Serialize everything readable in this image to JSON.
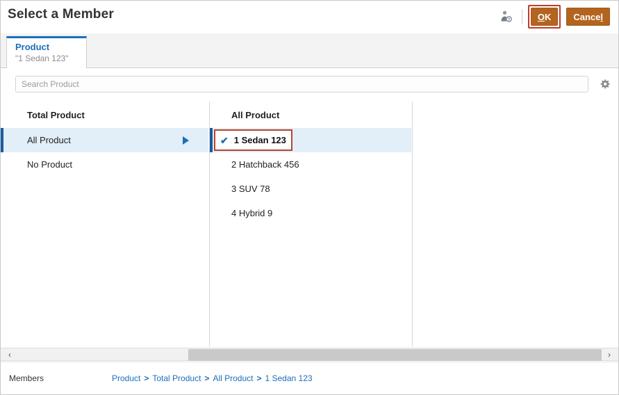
{
  "header": {
    "title": "Select a Member",
    "member_icon": "member-info-icon",
    "ok_label": "OK",
    "ok_accel": "O",
    "ok_rest": "K",
    "cancel_label": "Cance",
    "cancel_accel": "l",
    "ok_focus_color": "#c0392b",
    "button_color": "#b3641f"
  },
  "tabs": [
    {
      "label": "Product",
      "sublabel": "\"1 Sedan 123\"",
      "active": true,
      "accent_color": "#1a6fba"
    }
  ],
  "search": {
    "placeholder": "Search Product",
    "value": "",
    "gear_icon": "gear-icon"
  },
  "columns": [
    {
      "header": "Total Product",
      "items": [
        {
          "label": "All Product",
          "selected": true,
          "has_drill_arrow": true
        },
        {
          "label": "No Product",
          "selected": false,
          "has_drill_arrow": false
        }
      ]
    },
    {
      "header": "All Product",
      "items": [
        {
          "label": "1 Sedan 123",
          "selected": true,
          "checked": true,
          "focused": true
        },
        {
          "label": "2 Hatchback 456",
          "selected": false,
          "checked": false,
          "focused": false
        },
        {
          "label": "3 SUV 78",
          "selected": false,
          "checked": false,
          "focused": false
        },
        {
          "label": "4 Hybrid 9",
          "selected": false,
          "checked": false,
          "focused": false
        }
      ]
    },
    {
      "header": "",
      "items": []
    }
  ],
  "scrollbar": {
    "left_arrow": "‹",
    "right_arrow": "›"
  },
  "footer": {
    "label": "Members",
    "separator": ">",
    "breadcrumb": [
      "Product",
      "Total Product",
      "All Product",
      "1 Sedan 123"
    ]
  },
  "colors": {
    "selection_bg": "#e2eef8",
    "selection_bar": "#1b5c9c",
    "link": "#1a6fba",
    "focus_red": "#b8432c"
  }
}
